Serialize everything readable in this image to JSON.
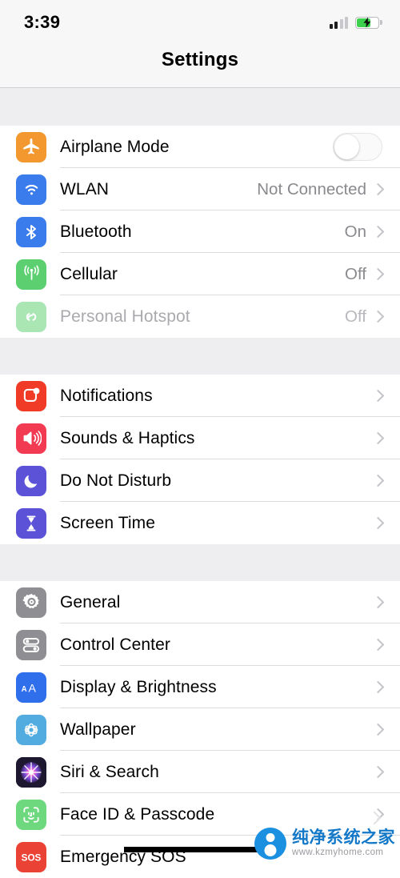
{
  "status_bar": {
    "time": "3:39",
    "signal_icon": "cellular-signal-icon",
    "signal_bars_filled": 2,
    "signal_bars_total": 4,
    "battery_icon": "battery-charging-icon",
    "battery_level_percent": 62,
    "battery_charging": true
  },
  "header": {
    "title": "Settings"
  },
  "groups": [
    {
      "name": "connectivity",
      "rows": [
        {
          "label": "Airplane Mode",
          "icon": "airplane-icon",
          "icon_color": "#f2982e",
          "control": "toggle",
          "toggle_on": false,
          "value": "",
          "disabled": false
        },
        {
          "label": "WLAN",
          "icon": "wifi-icon",
          "icon_color": "#3b7ced",
          "control": "chevron",
          "value": "Not Connected",
          "disabled": false
        },
        {
          "label": "Bluetooth",
          "icon": "bluetooth-icon",
          "icon_color": "#3b7ced",
          "control": "chevron",
          "value": "On",
          "disabled": false
        },
        {
          "label": "Cellular",
          "icon": "cellular-antenna-icon",
          "icon_color": "#5cd070",
          "control": "chevron",
          "value": "Off",
          "disabled": false
        },
        {
          "label": "Personal Hotspot",
          "icon": "hotspot-link-icon",
          "icon_color": "#a9e6b4",
          "control": "chevron",
          "value": "Off",
          "disabled": true
        }
      ]
    },
    {
      "name": "alerts",
      "rows": [
        {
          "label": "Notifications",
          "icon": "notifications-icon",
          "icon_color": "#f03c26",
          "control": "chevron",
          "value": "",
          "disabled": false
        },
        {
          "label": "Sounds & Haptics",
          "icon": "speaker-icon",
          "icon_color": "#f23b52",
          "control": "chevron",
          "value": "",
          "disabled": false
        },
        {
          "label": "Do Not Disturb",
          "icon": "moon-icon",
          "icon_color": "#5b52d8",
          "control": "chevron",
          "value": "",
          "disabled": false
        },
        {
          "label": "Screen Time",
          "icon": "hourglass-icon",
          "icon_color": "#5b52d8",
          "control": "chevron",
          "value": "",
          "disabled": false
        }
      ]
    },
    {
      "name": "system",
      "rows": [
        {
          "label": "General",
          "icon": "gear-icon",
          "icon_color": "#8e8e93",
          "control": "chevron",
          "value": "",
          "disabled": false
        },
        {
          "label": "Control Center",
          "icon": "control-center-icon",
          "icon_color": "#8e8e93",
          "control": "chevron",
          "value": "",
          "disabled": false
        },
        {
          "label": "Display & Brightness",
          "icon": "display-brightness-aa-icon",
          "icon_color": "#2f6fec",
          "control": "chevron",
          "value": "",
          "disabled": false
        },
        {
          "label": "Wallpaper",
          "icon": "wallpaper-flower-icon",
          "icon_color": "#53acdf",
          "control": "chevron",
          "value": "",
          "disabled": false
        },
        {
          "label": "Siri & Search",
          "icon": "siri-orb-icon",
          "icon_color": "#221b2e",
          "control": "chevron",
          "value": "",
          "disabled": false
        },
        {
          "label": "Face ID & Passcode",
          "icon": "face-id-icon",
          "icon_color": "#6ed87e",
          "control": "chevron",
          "value": "",
          "disabled": false
        },
        {
          "label": "Emergency SOS",
          "icon": "sos-icon",
          "icon_color": "#ea4335",
          "control": "none",
          "value": "",
          "disabled": false
        }
      ]
    }
  ],
  "watermark": {
    "name_cn": "纯净系统之家",
    "url": "www.kzmyhome.com",
    "logo_color": "#1b8fe0",
    "text_color": "#1478c8"
  }
}
